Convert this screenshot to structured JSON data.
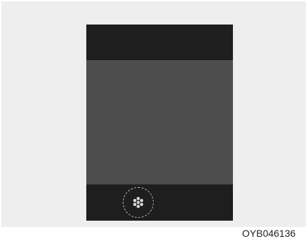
{
  "screen": {
    "background_color": "#eeeeee",
    "display_colors": {
      "top": "#1f1f1f",
      "main": "#4d4d4d",
      "bottom": "#1e1e1e"
    },
    "indicator_icon": "snowflake-icon"
  },
  "caption": {
    "code": "OYB046136"
  }
}
